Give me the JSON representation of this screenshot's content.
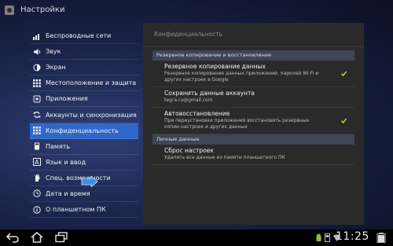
{
  "app": {
    "title": "Настройки",
    "icon": "settings-icon"
  },
  "sidebar": {
    "items": [
      {
        "label": "Беспроводные сети",
        "icon": "wireless-icon"
      },
      {
        "label": "Звук",
        "icon": "speaker-icon"
      },
      {
        "label": "Экран",
        "icon": "brightness-icon"
      },
      {
        "label": "Местоположение и защита",
        "icon": "grid-icon"
      },
      {
        "label": "Приложения",
        "icon": "apps-icon"
      },
      {
        "label": "Аккаунты и синхронизация",
        "icon": "sync-icon"
      },
      {
        "label": "Конфиденциальность",
        "icon": "privacy-icon",
        "active": true
      },
      {
        "label": "Память",
        "icon": "storage-icon"
      },
      {
        "label": "Язык и ввод",
        "icon": "language-icon"
      },
      {
        "label": "Спец. возможности",
        "icon": "hand-icon"
      },
      {
        "label": "Дата и время",
        "icon": "clock-icon"
      },
      {
        "label": "О планшетном ПК",
        "icon": "info-icon"
      }
    ]
  },
  "panel": {
    "title": "Конфиденциальность",
    "sections": [
      {
        "header": "Резервное копирование и восстановление"
      },
      {
        "header": "Личные данные"
      }
    ],
    "settings": {
      "backup": {
        "title": "Резервное копирование данных",
        "summary": "Резервное копирование данных приложений, паролей Wi-Fi и других настроек в Google",
        "checked": true
      },
      "account": {
        "title": "Сохранить данные аккаунта",
        "summary": "tegra.ru@gmail.com"
      },
      "restore": {
        "title": "Автовосстановление",
        "summary": "При переустановке приложения восстановить резервные копии настроек и других данных",
        "checked": true
      },
      "reset": {
        "title": "Сброс настроек",
        "summary": "Удалить все данные из памяти планшетного ПК"
      }
    }
  },
  "statusbar": {
    "time": "11:25"
  },
  "colors": {
    "accent": "#2f68c9",
    "check": "#b5d21b",
    "panel": "#2a2a2a"
  }
}
